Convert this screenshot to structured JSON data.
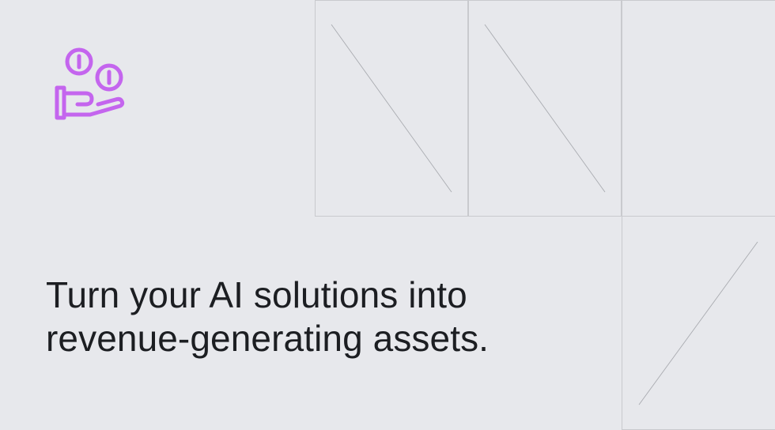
{
  "hero": {
    "icon": "hand-holding-coins-icon",
    "accent_color": "#c465ee",
    "headline_lines": [
      "Turn your AI solutions into",
      "revenue-generating assets."
    ]
  }
}
